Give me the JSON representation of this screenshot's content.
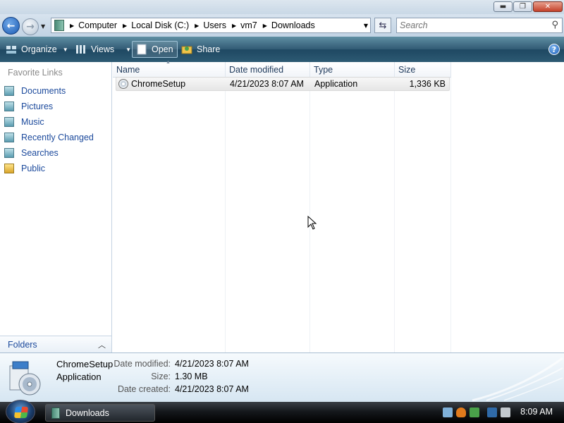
{
  "window": {
    "controls": {
      "minimize": "▬",
      "maximize": "❐",
      "close": "✕"
    }
  },
  "address": {
    "crumbs": [
      "Computer",
      "Local Disk (C:)",
      "Users",
      "vm7",
      "Downloads"
    ],
    "search_placeholder": "Search"
  },
  "toolbar": {
    "organize": "Organize",
    "views": "Views",
    "open": "Open",
    "share": "Share",
    "help": "?"
  },
  "sidebar": {
    "title": "Favorite Links",
    "items": [
      {
        "label": "Documents",
        "icon": "documents-icon"
      },
      {
        "label": "Pictures",
        "icon": "pictures-icon"
      },
      {
        "label": "Music",
        "icon": "music-icon"
      },
      {
        "label": "Recently Changed",
        "icon": "recently-changed-icon"
      },
      {
        "label": "Searches",
        "icon": "searches-icon"
      },
      {
        "label": "Public",
        "icon": "public-folder-icon"
      }
    ],
    "folders_label": "Folders"
  },
  "filelist": {
    "columns": [
      "Name",
      "Date modified",
      "Type",
      "Size"
    ],
    "rows": [
      {
        "name": "ChromeSetup",
        "date_modified": "4/21/2023 8:07 AM",
        "type": "Application",
        "size": "1,336 KB"
      }
    ]
  },
  "details": {
    "name": "ChromeSetup",
    "type": "Application",
    "date_modified_label": "Date modified:",
    "date_modified": "4/21/2023 8:07 AM",
    "size_label": "Size:",
    "size": "1.30 MB",
    "date_created_label": "Date created:",
    "date_created": "4/21/2023 8:07 AM"
  },
  "taskbar": {
    "window_button": "Downloads",
    "clock": "8:09 AM"
  },
  "colors": {
    "link": "#1c4a9c",
    "toolbar": "#2d5a73",
    "taskbar": "#15181c"
  }
}
